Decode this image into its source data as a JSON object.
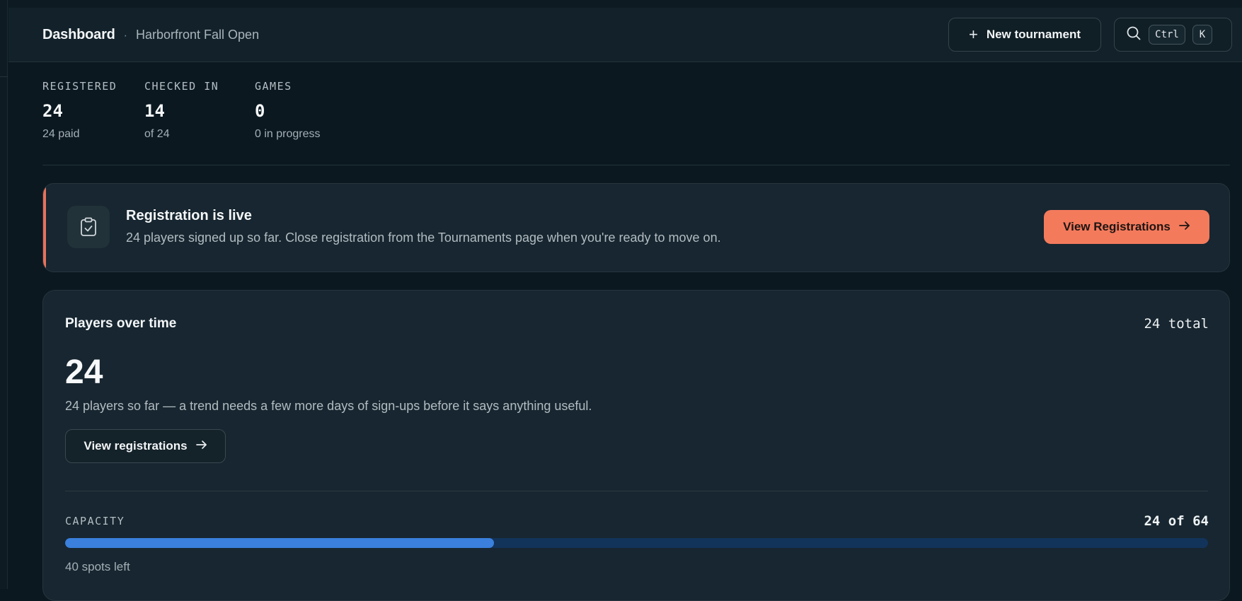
{
  "header": {
    "title": "Dashboard",
    "separator": "·",
    "subtitle": "Harborfront Fall Open",
    "new_button_label": "New tournament",
    "search_shortcut": [
      "Ctrl",
      "K"
    ]
  },
  "stats": [
    {
      "label": "REGISTERED",
      "value": "24",
      "sub": "24 paid"
    },
    {
      "label": "CHECKED IN",
      "value": "14",
      "sub": "of 24"
    },
    {
      "label": "GAMES",
      "value": "0",
      "sub": "0 in progress"
    }
  ],
  "banner": {
    "title": "Registration is live",
    "description": "24 players signed up so far. Close registration from the Tournaments page when you're ready to move on.",
    "button_label": "View Registrations",
    "accent_color": "#e9715a"
  },
  "players_card": {
    "title": "Players over time",
    "total": "24 total",
    "count": "24",
    "description": "24 players so far — a trend needs a few more days of sign-ups before it says anything useful.",
    "button_label": "View registrations"
  },
  "capacity": {
    "label": "CAPACITY",
    "value_text": "24 of 64",
    "registered": 24,
    "max": 64,
    "remaining_text": "40 spots left",
    "fill_color": "#3a80dc",
    "track_color": "#12335a"
  },
  "colors": {
    "background": "#0b1820",
    "card": "#172630",
    "primary": "#f47a5c"
  }
}
